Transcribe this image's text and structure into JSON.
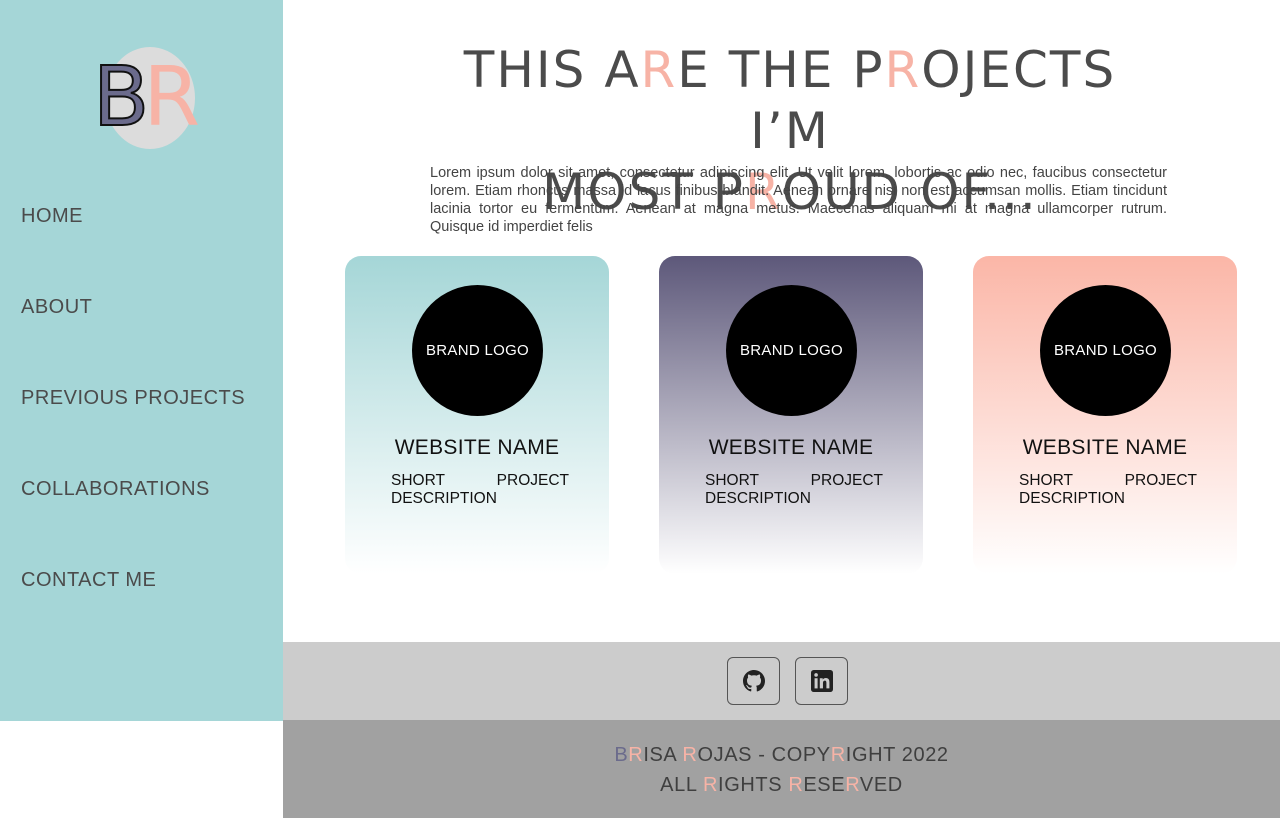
{
  "brand": {
    "logo_text": "BR",
    "colors": {
      "sidebar": "#a5d6d7",
      "accent_pink": "#f7b3a6",
      "accent_purple": "#5d587a"
    }
  },
  "nav": {
    "items": [
      {
        "label": "HOME"
      },
      {
        "label": "ABOUT"
      },
      {
        "label": "PREVIOUS PROJECTS"
      },
      {
        "label": "COLLABORATIONS"
      },
      {
        "label": "CONTACT ME"
      }
    ]
  },
  "main": {
    "title_line1_parts": [
      "THIS A",
      "R",
      "E THE P",
      "R",
      "OJECTS I’M"
    ],
    "title_line2_parts": [
      "MOST P",
      "R",
      "OUD OF..."
    ],
    "intro": "Lorem ipsum dolor sit amet, consectetur adipiscing elit. Ut velit lorem, lobortis ac odio nec, faucibus consectetur lorem. Etiam rhoncus massa id lacus finibus blandit. Aenean ornare nisi non est accumsan mollis. Etiam tincidunt lacinia tortor eu fermentum. Aenean at magna metus. Maecenas aliquam mi at magna ullamcorper rutrum. Quisque id imperdiet felis"
  },
  "projects": [
    {
      "logo": "BRAND LOGO",
      "name": "WEBSITE NAME",
      "desc_a": "SHORT",
      "desc_b": "PROJECT",
      "desc_c": "DESCRIPTION"
    },
    {
      "logo": "BRAND LOGO",
      "name": "WEBSITE NAME",
      "desc_a": "SHORT",
      "desc_b": "PROJECT",
      "desc_c": "DESCRIPTION"
    },
    {
      "logo": "BRAND LOGO",
      "name": "WEBSITE NAME",
      "desc_a": "SHORT",
      "desc_b": "PROJECT",
      "desc_c": "DESCRIPTION"
    }
  ],
  "social": {
    "github_icon": "github-icon",
    "linkedin_icon": "linkedin-icon"
  },
  "footer": {
    "line1_parts": [
      "B",
      "R",
      "ISA ",
      "R",
      "OJAS - COPY",
      "R",
      "IGHT 2022"
    ],
    "line2_parts": [
      "ALL ",
      "R",
      "IGHTS ",
      "R",
      "ESE",
      "R",
      "VED"
    ]
  }
}
